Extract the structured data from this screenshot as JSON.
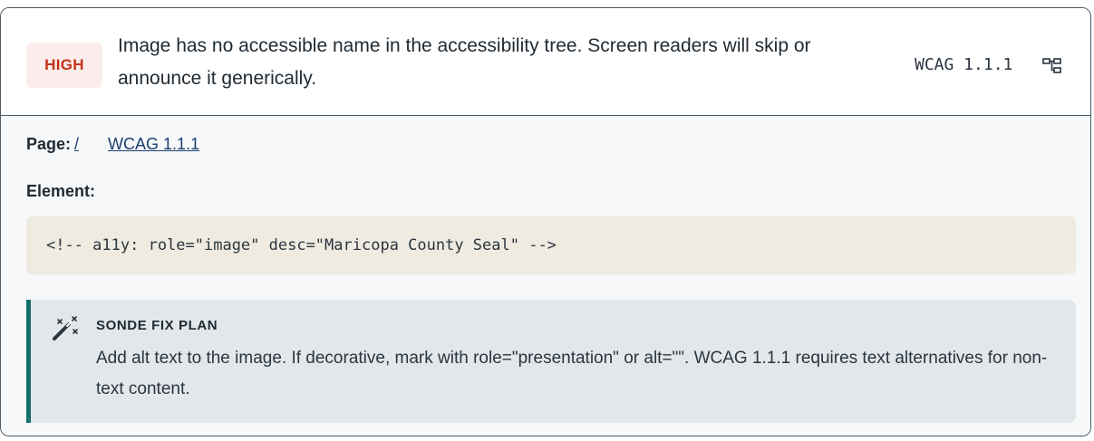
{
  "issue": {
    "severity": "HIGH",
    "description": "Image has no accessible name in the accessibility tree. Screen readers will skip or announce it generically.",
    "wcag_code": "WCAG 1.1.1",
    "tree_icon": "tree-structure-icon"
  },
  "details": {
    "page_label": "Page:",
    "page_link": "/",
    "wcag_link": "WCAG 1.1.1",
    "element_label": "Element:",
    "element_code": "<!-- a11y: role=\"image\" desc=\"Maricopa County Seal\" -->"
  },
  "fix_plan": {
    "icon": "magic-wand-icon",
    "title": "SONDE FIX PLAN",
    "text": "Add alt text to the image. If decorative, mark with role=\"presentation\" or alt=\"\". WCAG 1.1.1 requires text alternatives for non-text content."
  },
  "colors": {
    "severity_text": "#c4321a",
    "severity_bg": "#fdecec",
    "accent": "#13706a",
    "code_bg": "#efebe0",
    "link": "#1c3f6e"
  }
}
